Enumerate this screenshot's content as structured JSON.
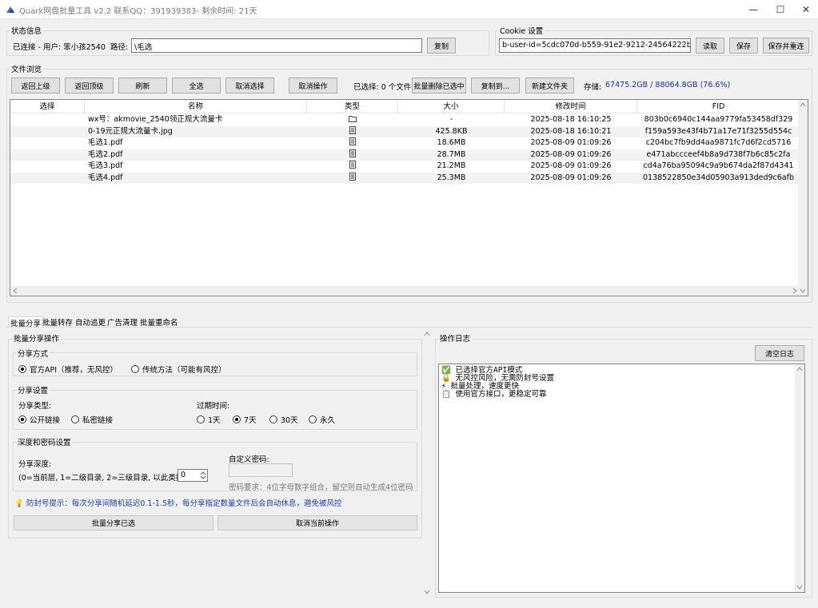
{
  "window": {
    "title": "Quark网盘批量工具 v2.2 联系QQ：391939383- 剩余时间: 21天",
    "minimize": "—",
    "maximize": "☐",
    "close": "✕"
  },
  "status": {
    "group_title": "状态信息",
    "connection": "已连接 - 用户: 笨小孩2540",
    "path_label": "路径:",
    "path_value": "\\毛选",
    "copy_button": "复制"
  },
  "cookie": {
    "group_title": "Cookie 设置",
    "value": "b-user-id=5cdc070d-b559-91e2-9212-24564222b513; _",
    "read_button": "读取",
    "save_button": "保存",
    "save_reconnect_button": "保存并重连"
  },
  "browser": {
    "group_title": "文件浏览",
    "toolbar": {
      "up": "返回上级",
      "top": "返回顶级",
      "refresh": "刷新",
      "select_all": "全选",
      "deselect": "取消选择",
      "cancel_op": "取消操作",
      "selected_count": "已选择: 0 个文件",
      "batch_delete": "批量删除已选中",
      "copy_to": "复制到...",
      "new_folder": "新建文件夹",
      "storage_label": "存储:",
      "storage_value": "67475.2GB / 88064.8GB (76.6%)"
    },
    "columns": [
      "选择",
      "名称",
      "类型",
      "大小",
      "修改时间",
      "FID"
    ],
    "rows": [
      {
        "name": "wx号：akmovie_2540领正规大流量卡",
        "type": "folder",
        "size": "-",
        "mtime": "2025-08-18 16:10:25",
        "fid": "803b0c6940c144aa9779fa53458df329"
      },
      {
        "name": "0-19元正规大流量卡.jpg",
        "type": "file",
        "size": "425.8KB",
        "mtime": "2025-08-18 16:10:21",
        "fid": "f159a593e43f4b71a17e71f3255d554c"
      },
      {
        "name": "毛选1.pdf",
        "type": "file",
        "size": "18.6MB",
        "mtime": "2025-08-09 01:09:26",
        "fid": "c204bc7fb9dd4aa9871fc7d6f2cd5716"
      },
      {
        "name": "毛选2.pdf",
        "type": "file",
        "size": "28.7MB",
        "mtime": "2025-08-09 01:09:26",
        "fid": "e471abccceef4b8a9d738f7b6c85c2fa"
      },
      {
        "name": "毛选3.pdf",
        "type": "file",
        "size": "21.2MB",
        "mtime": "2025-08-09 01:09:26",
        "fid": "cd4a76ba95094c9a9b674da2f87d4341"
      },
      {
        "name": "毛选4.pdf",
        "type": "file",
        "size": "25.3MB",
        "mtime": "2025-08-09 01:09:26",
        "fid": "0138522850e34d05903a913ded9c6afb"
      }
    ]
  },
  "tabs": [
    "批量分享",
    "批量转存",
    "自动追更",
    "广告清理",
    "批量重命名"
  ],
  "share": {
    "group_title": "批量分享操作",
    "method": {
      "title": "分享方式",
      "options": [
        "官方API（推荐，无风控）",
        "传统方法（可能有风控）"
      ],
      "selected": 0
    },
    "settings": {
      "title": "分享设置",
      "type_label": "分享类型:",
      "type_options": [
        "公开链接",
        "私密链接"
      ],
      "type_selected": 0,
      "expire_label": "过期时间:",
      "expire_options": [
        "1天",
        "7天",
        "30天",
        "永久"
      ],
      "expire_selected": 1
    },
    "depth": {
      "title": "深度和密码设置",
      "depth_label": "分享深度:",
      "depth_hint": "(0=当前层, 1=二级目录, 2=三级目录, 以此类推):",
      "depth_value": "0",
      "pwd_label": "自定义密码:",
      "pwd_value": "",
      "pwd_hint": "密码要求：4位字母数字组合，留空则自动生成4位密码"
    },
    "tip": "防封号提示：每次分享间随机延迟0.1-1.5秒，每分享指定数量文件后会自动休息，避免被风控",
    "share_button": "批量分享已选",
    "cancel_button": "取消当前操作"
  },
  "log": {
    "title": "操作日志",
    "clear_button": "清空日志",
    "lines": [
      "✅ 已选择官方API模式",
      "🔒 无风控风险，无需防封号设置",
      "⚡ 批量处理，速度更快",
      "📋 使用官方接口，更稳定可靠"
    ]
  },
  "colors": {
    "accent": "#1b2fb8",
    "tip": "#1a3cc2",
    "alt_row": "#f3f3f3"
  }
}
